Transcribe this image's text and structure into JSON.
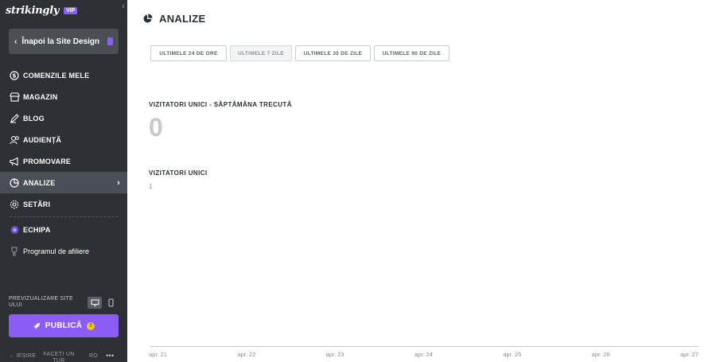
{
  "sidebar": {
    "logo": "strikingly",
    "vip_badge": "VIP",
    "back_label": "Înapoi la Site Design",
    "items": [
      {
        "label": "COMENZILE MELE",
        "icon": "dollar-circle-icon"
      },
      {
        "label": "MAGAZIN",
        "icon": "store-icon"
      },
      {
        "label": "BLOG",
        "icon": "pen-icon"
      },
      {
        "label": "AUDIENȚĂ",
        "icon": "users-icon"
      },
      {
        "label": "PROMOVARE",
        "icon": "megaphone-icon"
      },
      {
        "label": "ANALIZE",
        "icon": "pie-chart-icon",
        "active": true
      },
      {
        "label": "SETĂRI",
        "icon": "gear-icon"
      },
      {
        "label": "ECHIPA",
        "icon": "team-icon"
      },
      {
        "label": "Programul de afiliere",
        "icon": "trophy-icon"
      }
    ],
    "preview_label": "PREVIZUALIZARE SITE ULUI",
    "publish_label": "PUBLICĂ",
    "publish_badge": "!",
    "footer": {
      "exit": "← IEȘIRE",
      "tour": "FACEȚI UN TUR",
      "lang": "RO",
      "more": "•••"
    }
  },
  "main": {
    "title": "ANALIZE",
    "tabs": [
      {
        "label": "ULTIMELE 24 DE ORE"
      },
      {
        "label": "ULTIMELE 7 ZILE",
        "active": true
      },
      {
        "label": "ULTIMELE 30 DE ZILE"
      },
      {
        "label": "ULTIMELE 90 DE ZILE"
      }
    ],
    "metric1": {
      "title": "VIZITATORI UNICI - SĂPTĂMÂNA TRECUTĂ",
      "value": "0"
    },
    "metric2": {
      "title": "VIZITATORI UNICI",
      "y_label": "1"
    }
  },
  "chart_data": {
    "type": "line",
    "title": "VIZITATORI UNICI",
    "categories": [
      "apr. 21",
      "apr. 22",
      "apr. 23",
      "apr. 24",
      "apr. 25",
      "apr. 26",
      "apr. 27"
    ],
    "values": [
      0,
      0,
      0,
      0,
      0,
      0,
      0
    ],
    "ylim": [
      0,
      1
    ],
    "colors": {
      "axis": "#c9ccd1",
      "accent": "#8b5cf6"
    }
  }
}
